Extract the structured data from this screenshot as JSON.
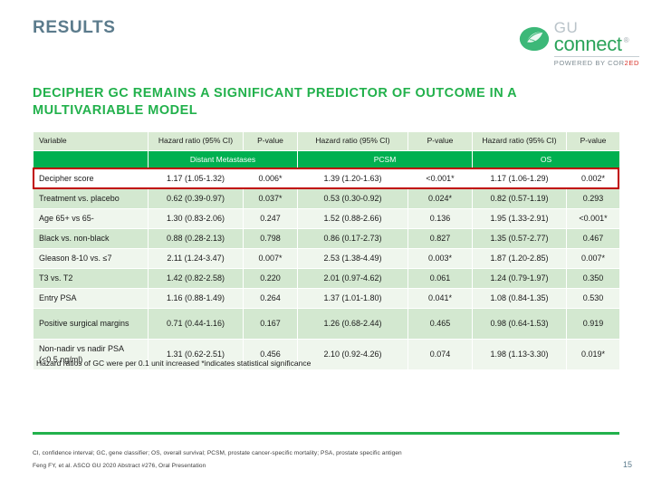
{
  "slide": {
    "title": "RESULTS",
    "headline": "DECIPHER GC REMAINS A SIGNIFICANT PREDICTOR OF OUTCOME IN A MULTIVARIABLE MODEL",
    "page_number": "15"
  },
  "logo": {
    "gu": "GU",
    "connect": "connect",
    "tm": "®",
    "powered_prefix": "POWERED BY COR",
    "powered_accent": "2ED",
    "mark_icon": "gu-connect-leaf-icon"
  },
  "table": {
    "col_variable": "Variable",
    "col_hr": "Hazard ratio (95% CI)",
    "col_p": "P-value",
    "group_dm": "Distant Metastases",
    "group_pcsm": "PCSM",
    "group_os": "OS",
    "rows": [
      {
        "variable": "Decipher score",
        "dm_hr": "1.17 (1.05-1.32)",
        "dm_p": "0.006*",
        "dm_p_bold": true,
        "pcsm_hr": "1.39 (1.20-1.63)",
        "pcsm_p": "<0.001*",
        "pcsm_p_bold": true,
        "os_hr": "1.17 (1.06-1.29)",
        "os_p": "0.002*",
        "os_p_bold": true,
        "highlight": true,
        "bold_row": true
      },
      {
        "variable": "Treatment vs. placebo",
        "dm_hr": "0.62 (0.39-0.97)",
        "dm_p": "0.037*",
        "pcsm_hr": "0.53 (0.30-0.92)",
        "pcsm_p": "0.024*",
        "os_hr": "0.82 (0.57-1.19)",
        "os_p": "0.293"
      },
      {
        "variable": "Age 65+ vs 65-",
        "dm_hr": "1.30 (0.83-2.06)",
        "dm_p": "0.247",
        "pcsm_hr": "1.52 (0.88-2.66)",
        "pcsm_p": "0.136",
        "os_hr": "1.95 (1.33-2.91)",
        "os_p": "<0.001*"
      },
      {
        "variable": "Black vs. non-black",
        "dm_hr": "0.88 (0.28-2.13)",
        "dm_p": "0.798",
        "pcsm_hr": "0.86 (0.17-2.73)",
        "pcsm_p": "0.827",
        "os_hr": "1.35 (0.57-2.77)",
        "os_p": "0.467"
      },
      {
        "variable": "Gleason 8-10 vs. ≤7",
        "dm_hr": "2.11 (1.24-3.47)",
        "dm_p": "0.007*",
        "pcsm_hr": "2.53 (1.38-4.49)",
        "pcsm_p": "0.003*",
        "os_hr": "1.87 (1.20-2.85)",
        "os_p": "0.007*"
      },
      {
        "variable": "T3 vs. T2",
        "dm_hr": "1.42 (0.82-2.58)",
        "dm_p": "0.220",
        "pcsm_hr": "2.01 (0.97-4.62)",
        "pcsm_p": "0.061",
        "os_hr": "1.24 (0.79-1.97)",
        "os_p": "0.350"
      },
      {
        "variable": "Entry PSA",
        "dm_hr": "1.16 (0.88-1.49)",
        "dm_p": "0.264",
        "pcsm_hr": "1.37 (1.01-1.80)",
        "pcsm_p": "0.041*",
        "os_hr": "1.08 (0.84-1.35)",
        "os_p": "0.530"
      },
      {
        "variable": "Positive surgical margins",
        "dm_hr": "0.71 (0.44-1.16)",
        "dm_p": "0.167",
        "pcsm_hr": "1.26 (0.68-2.44)",
        "pcsm_p": "0.465",
        "os_hr": "0.98 (0.64-1.53)",
        "os_p": "0.919",
        "tall": true
      },
      {
        "variable": "Non-nadir vs nadir PSA (<0.5 ng/ml)",
        "dm_hr": "1.31 (0.62-2.51)",
        "dm_p": "0.456",
        "pcsm_hr": "2.10 (0.92-4.26)",
        "pcsm_p": "0.074",
        "os_hr": "1.98 (1.13-3.30)",
        "os_p": "0.019*",
        "tall": true
      }
    ]
  },
  "footnote": "Hazard ratios of GC were per 0.1 unit increased  *indicates statistical significance",
  "abbreviations": "CI, confidence interval; GC, gene classifier; OS, overall survival; PCSM, prostate cancer-specific mortality; PSA, prostate specific antigen",
  "citation": "Feng FY, et al.  ASCO GU 2020 Abstract #276, Oral Presentation"
}
